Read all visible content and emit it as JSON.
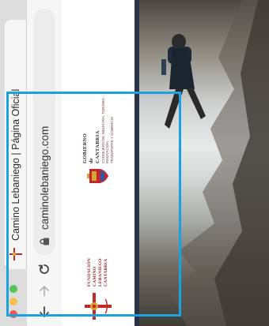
{
  "browser": {
    "tab": {
      "title": "Camino Lebaniego | Página Oficial",
      "favicon": "camino-cross-icon"
    },
    "toolbar": {
      "back_icon": "back-arrow-icon",
      "forward_icon": "forward-arrow-icon",
      "reload_icon": "reload-icon"
    },
    "address_bar": {
      "url": "caminolebaniego.com",
      "lock_icon": "lock-icon"
    }
  },
  "page": {
    "brand_left": {
      "icon": "camino-cross-icon",
      "lines": [
        "FUNDACIÓN",
        "CAMINO",
        "LEBANIEGO",
        "CANTABRIA"
      ]
    },
    "brand_right": {
      "icon": "cantabria-shield-icon",
      "lines": [
        "GOBIERNO",
        "de",
        "CANTABRIA"
      ],
      "small_lines": [
        "CONSEJERÍA DE INDUSTRIA, TURISMO, INNOVACIÓN,",
        "TRANSPORTE Y COMERCIO"
      ]
    },
    "hero": {
      "description_icon": "hiker-photo"
    }
  },
  "colors": {
    "highlight": "#1ba0e0",
    "brand_red": "#c0282b",
    "gold": "#d6a532"
  }
}
